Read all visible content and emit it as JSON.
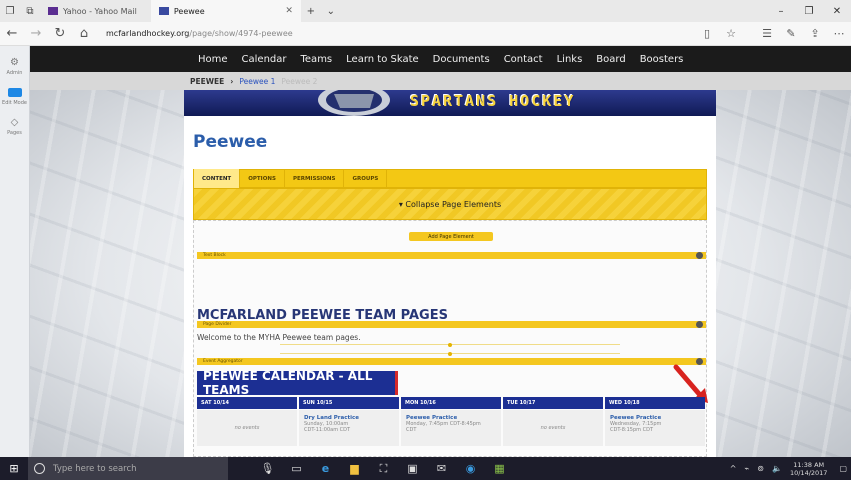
{
  "browser": {
    "tabs": [
      {
        "label": "Yahoo - Yahoo Mail",
        "active": false
      },
      {
        "label": "Peewee",
        "active": true
      }
    ],
    "url_domain": "mcfarlandhockey.org",
    "url_path": "/page/show/4974-peewee"
  },
  "admin_bar": {
    "items": [
      {
        "label": "Admin",
        "icon": "gear-icon"
      },
      {
        "label": "Edit Mode",
        "icon": "toggle-icon"
      },
      {
        "label": "Pages",
        "icon": "layers-icon"
      }
    ]
  },
  "nav": {
    "items": [
      "Home",
      "Calendar",
      "Teams",
      "Learn to Skate",
      "Documents",
      "Contact",
      "Links",
      "Board",
      "Boosters"
    ]
  },
  "breadcrumb": [
    "PEEWEE",
    "Peewee 1",
    "Peewee 2"
  ],
  "banner_text": "SPARTANS HOCKEY",
  "page": {
    "title": "Peewee",
    "tabs": [
      "CONTENT",
      "OPTIONS",
      "PERMISSIONS",
      "GROUPS"
    ],
    "collapse_label": "▾ Collapse Page Elements",
    "add_element_label": "Add Page Element",
    "elements": {
      "text_block": "Text Block",
      "page_divider": "Page Divider",
      "event_aggregator": "Event Aggregator"
    },
    "heading": "MCFARLAND PEEWEE TEAM PAGES",
    "welcome": "Welcome to the MYHA Peewee team pages.",
    "calendar_title": "PEEWEE CALENDAR - ALL TEAMS",
    "calendar_days": [
      {
        "label": "SAT 10/14",
        "event": null,
        "empty_text": "no events"
      },
      {
        "label": "SUN 10/15",
        "event": "Dry Land Practice",
        "line1": "Sunday, 10:00am",
        "line2": "CDT-11:00am CDT"
      },
      {
        "label": "MON 10/16",
        "event": "Peewee Practice",
        "line1": "Monday, 7:45pm CDT-8:45pm",
        "line2": "CDT"
      },
      {
        "label": "TUE 10/17",
        "event": null,
        "empty_text": "no events"
      },
      {
        "label": "WED 10/18",
        "event": "Peewee Practice",
        "line1": "Wednesday, 7:15pm",
        "line2": "CDT-8:15pm CDT"
      }
    ]
  },
  "taskbar": {
    "search_placeholder": "Type here to search",
    "time": "11:38 AM",
    "date": "10/14/2017"
  },
  "colors": {
    "brand_blue": "#1c2f93",
    "accent_yellow": "#f4c720",
    "title_blue": "#2b5daa"
  }
}
